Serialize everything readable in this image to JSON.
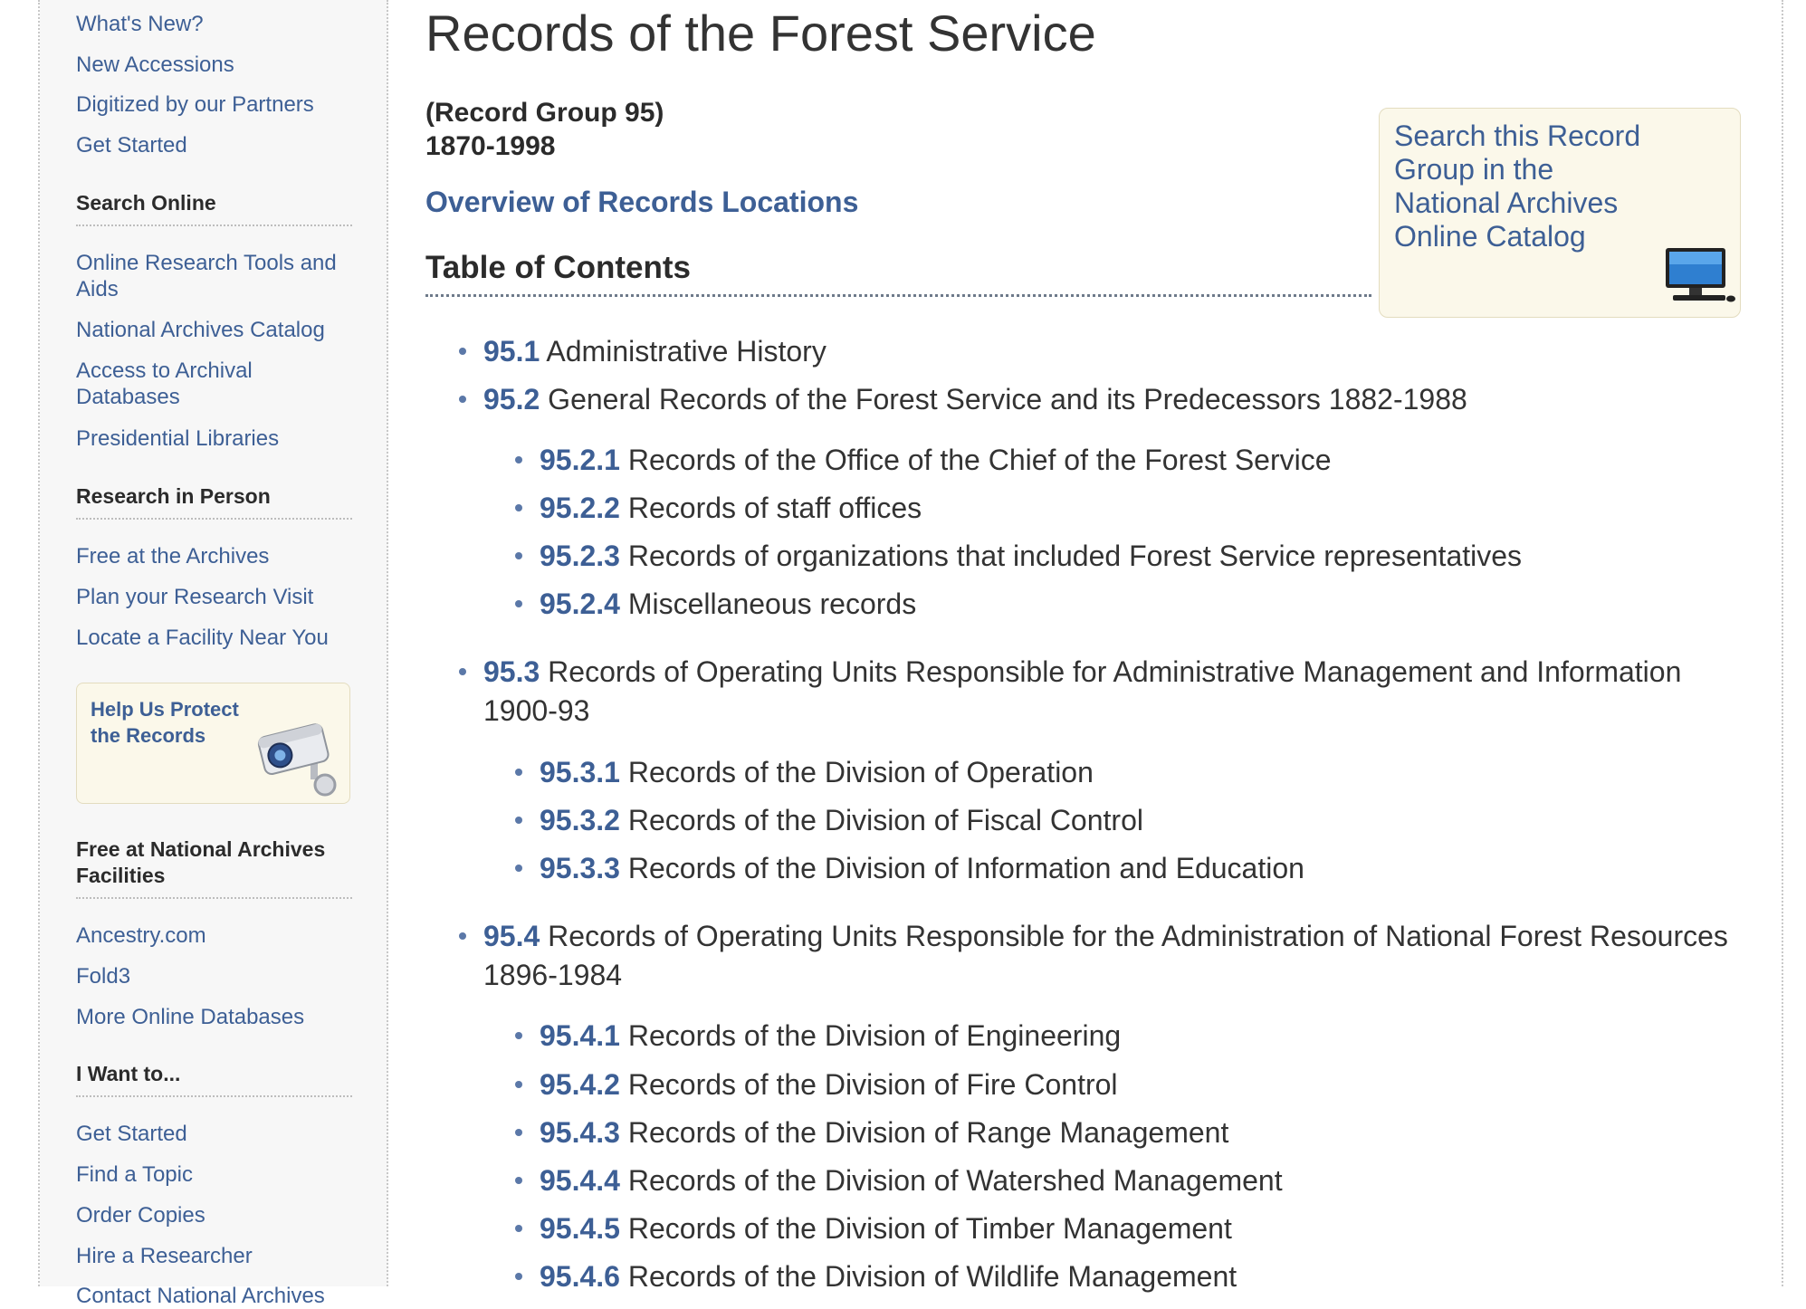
{
  "sidebar": {
    "top_links": [
      {
        "label": "What's New?"
      },
      {
        "label": "New Accessions"
      },
      {
        "label": "Digitized by our Partners"
      },
      {
        "label": "Get Started"
      }
    ],
    "search_online": {
      "heading": "Search Online",
      "links": [
        {
          "label": "Online Research Tools and Aids"
        },
        {
          "label": "National Archives Catalog"
        },
        {
          "label": "Access to Archival Databases"
        },
        {
          "label": "Presidential Libraries"
        }
      ]
    },
    "research_in_person": {
      "heading": "Research in Person",
      "links": [
        {
          "label": "Free at the Archives"
        },
        {
          "label": "Plan your Research Visit"
        },
        {
          "label": "Locate a Facility Near You"
        }
      ]
    },
    "protect_box": {
      "label": "Help Us Protect the Records",
      "icon": "security-camera-icon"
    },
    "free_facilities": {
      "heading": "Free at National Archives Facilities",
      "links": [
        {
          "label": "Ancestry.com"
        },
        {
          "label": "Fold3"
        },
        {
          "label": "More Online Databases"
        }
      ]
    },
    "i_want_to": {
      "heading": "I Want to...",
      "links": [
        {
          "label": "Get Started"
        },
        {
          "label": "Find a Topic"
        },
        {
          "label": "Order Copies"
        },
        {
          "label": "Hire a Researcher"
        },
        {
          "label": "Contact National Archives"
        }
      ]
    }
  },
  "main": {
    "title": "Records of the Forest Service",
    "record_group": "(Record Group 95)",
    "date_range": "1870-1998",
    "overview_link": "Overview of Records Locations",
    "toc_heading": "Table of Contents",
    "search_box": {
      "label": "Search this Record Group in the National Archives Online Catalog",
      "icon": "computer-icon"
    },
    "toc": [
      {
        "num": "95.1",
        "text": "Administrative History"
      },
      {
        "num": "95.2",
        "text": "General Records of the Forest Service and its Predecessors 1882-1988"
      },
      {
        "num": "95.2.1",
        "text": "Records of the Office of the Chief of the Forest Service"
      },
      {
        "num": "95.2.2",
        "text": "Records of staff offices"
      },
      {
        "num": "95.2.3",
        "text": "Records of organizations that included Forest Service representatives"
      },
      {
        "num": "95.2.4",
        "text": "Miscellaneous records"
      },
      {
        "num": "95.3",
        "text": "Records of Operating Units Responsible for Administrative Management and Information 1900-93"
      },
      {
        "num": "95.3.1",
        "text": "Records of the Division of Operation"
      },
      {
        "num": "95.3.2",
        "text": "Records of the Division of Fiscal Control"
      },
      {
        "num": "95.3.3",
        "text": "Records of the Division of Information and Education"
      },
      {
        "num": "95.4",
        "text": "Records of Operating Units Responsible for the Administration of National Forest Resources 1896-1984"
      },
      {
        "num": "95.4.1",
        "text": "Records of the Division of Engineering"
      },
      {
        "num": "95.4.2",
        "text": "Records of the Division of Fire Control"
      },
      {
        "num": "95.4.3",
        "text": "Records of the Division of Range Management"
      },
      {
        "num": "95.4.4",
        "text": "Records of the Division of Watershed Management"
      },
      {
        "num": "95.4.5",
        "text": "Records of the Division of Timber Management"
      },
      {
        "num": "95.4.6",
        "text": "Records of the Division of Wildlife Management"
      }
    ]
  },
  "colors": {
    "link": "#3d5f95",
    "text": "#333333",
    "sidebar_bg": "#f7f7f7",
    "callout_bg": "#fbf8ea"
  }
}
